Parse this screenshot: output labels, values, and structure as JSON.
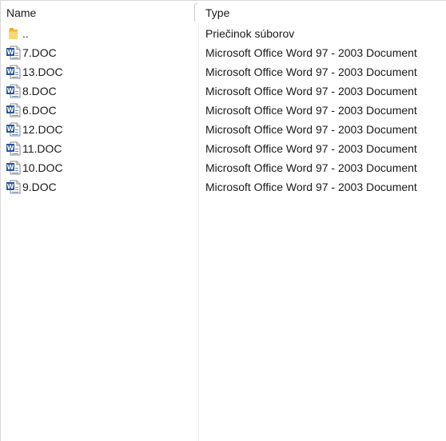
{
  "columns": {
    "name": "Name",
    "type": "Type"
  },
  "rows": [
    {
      "name": "..",
      "type": "Priečinok súborov",
      "icon": "folder-icon"
    },
    {
      "name": "7.DOC",
      "type": "Microsoft Office Word 97 - 2003 Document",
      "icon": "word-document-icon"
    },
    {
      "name": "13.DOC",
      "type": "Microsoft Office Word 97 - 2003 Document",
      "icon": "word-document-icon"
    },
    {
      "name": "8.DOC",
      "type": "Microsoft Office Word 97 - 2003 Document",
      "icon": "word-document-icon"
    },
    {
      "name": "6.DOC",
      "type": "Microsoft Office Word 97 - 2003 Document",
      "icon": "word-document-icon"
    },
    {
      "name": "12.DOC",
      "type": "Microsoft Office Word 97 - 2003 Document",
      "icon": "word-document-icon"
    },
    {
      "name": "11.DOC",
      "type": "Microsoft Office Word 97 - 2003 Document",
      "icon": "word-document-icon"
    },
    {
      "name": "10.DOC",
      "type": "Microsoft Office Word 97 - 2003 Document",
      "icon": "word-document-icon"
    },
    {
      "name": "9.DOC",
      "type": "Microsoft Office Word 97 - 2003 Document",
      "icon": "word-document-icon"
    }
  ],
  "colors": {
    "folder": "#f3c24a",
    "doc_accent": "#2b579a"
  }
}
